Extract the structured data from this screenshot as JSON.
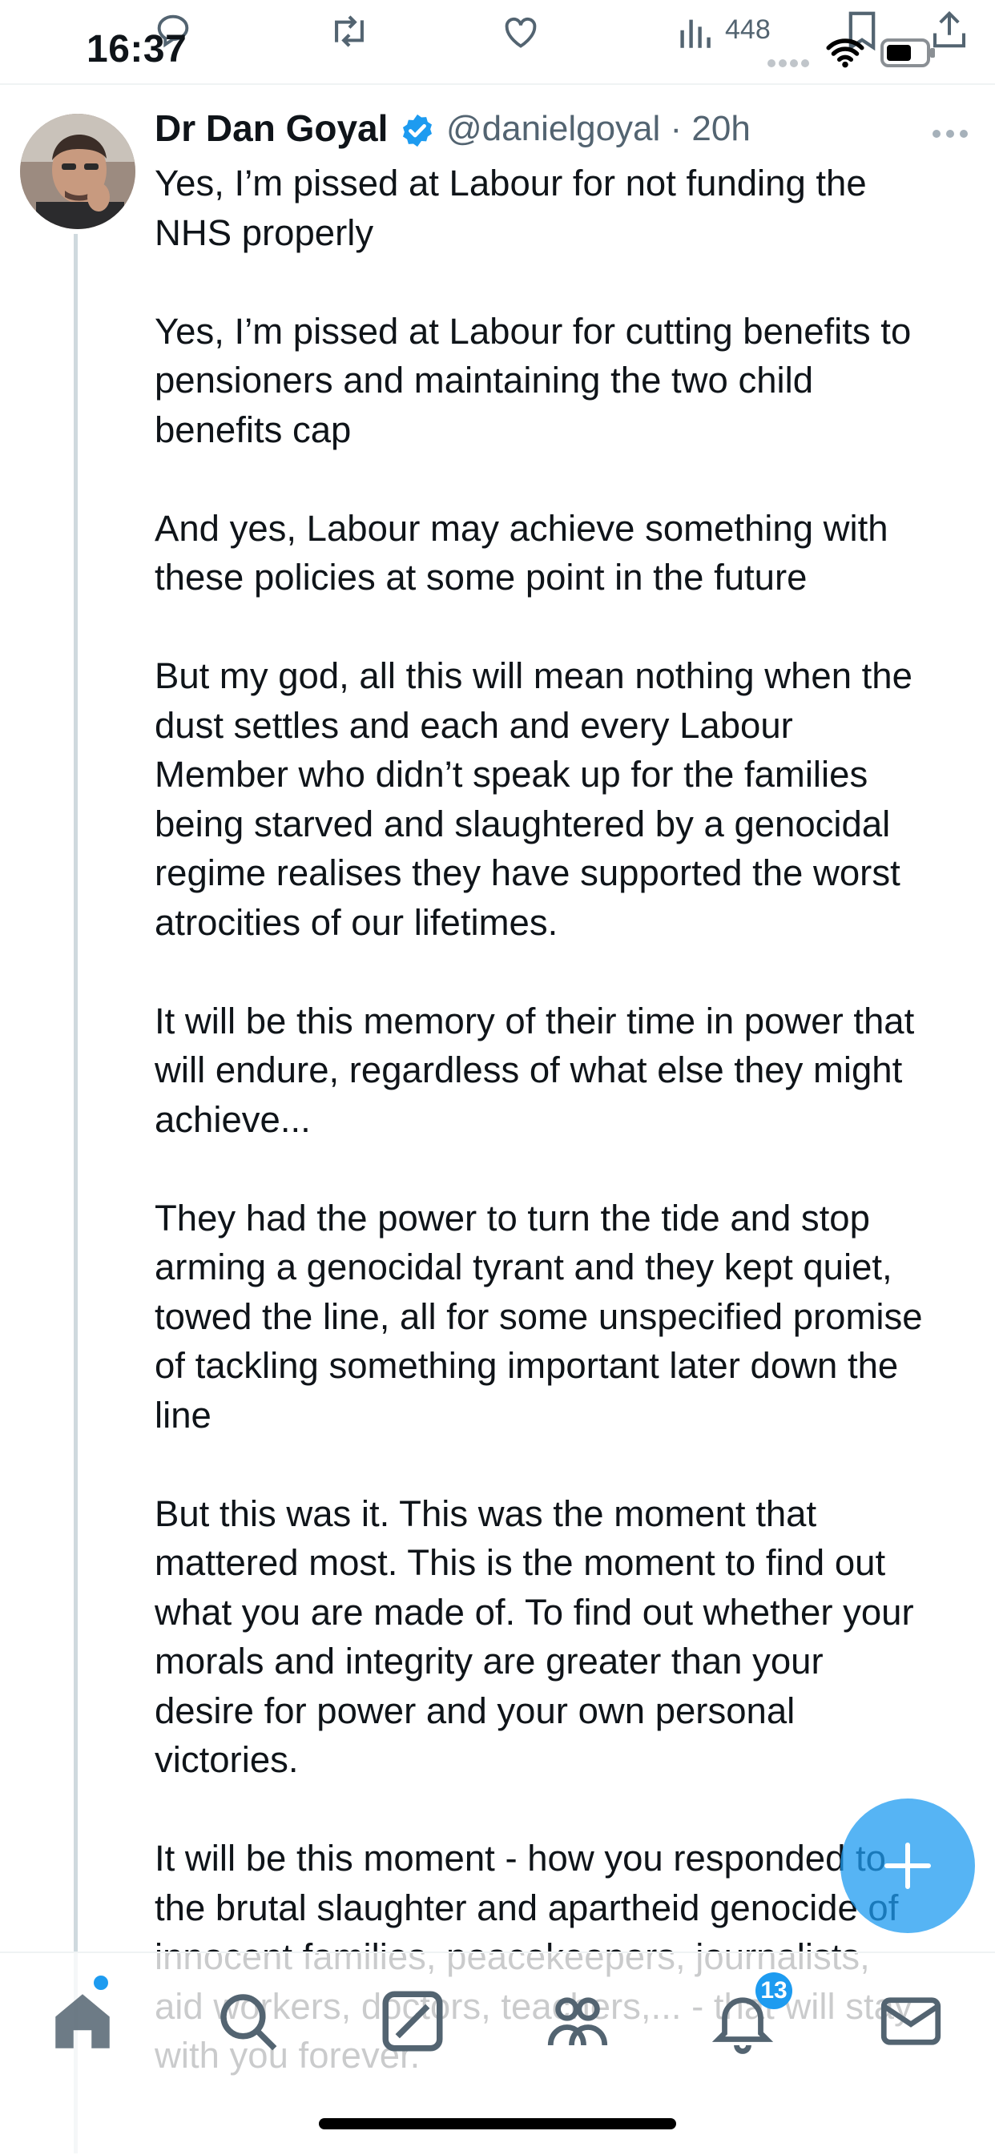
{
  "status_bar": {
    "time": "16:37"
  },
  "actions": {
    "views": "448"
  },
  "tweet": {
    "author_name": "Dr Dan Goyal",
    "handle_time": "@danielgoyal · 20h",
    "paragraphs": [
      "Yes, I’m pissed at Labour for not funding the\nNHS properly",
      "Yes, I’m pissed at Labour for cutting benefits to\npensioners and maintaining the two child\nbenefits cap",
      "And yes, Labour may achieve something with\nthese policies at some point in the future",
      "But my god, all this will mean nothing when the\ndust settles and each and every Labour\nMember who didn’t speak up for the families\nbeing starved and slaughtered by a genocidal\nregime realises they have supported the worst\natrocities of our lifetimes.",
      "It will be this memory of their time in power that\nwill endure, regardless of what else they might\nachieve...",
      "They had the power to turn the tide and stop\narming a genocidal tyrant and they kept quiet,\ntowed the line, all for some unspecified promise\nof tackling something important later down the\nline",
      "But this was it. This was the moment that\nmattered most. This is the moment to find out\nwhat you are made of. To find out whether your\nmorals and integrity are greater than your\ndesire for power and your own personal\nvictories.",
      "It will be this moment - how you responded to\nthe brutal slaughter and apartheid genocide of\ninnocent families, peacekeepers, journalists,\naid workers, doctors, teachers,... - that will stay\nwith you forever."
    ]
  },
  "nav": {
    "notifications_badge": "13"
  },
  "colors": {
    "accent": "#1d9bf0",
    "secondary_text": "#536471",
    "text": "#0f1419"
  },
  "icons": [
    "reply-icon",
    "retweet-icon",
    "like-icon",
    "views-icon",
    "bookmark-icon",
    "share-icon",
    "verified-icon",
    "more-icon",
    "home-icon",
    "search-icon",
    "grok-icon",
    "communities-icon",
    "notifications-icon",
    "messages-icon",
    "compose-icon"
  ]
}
